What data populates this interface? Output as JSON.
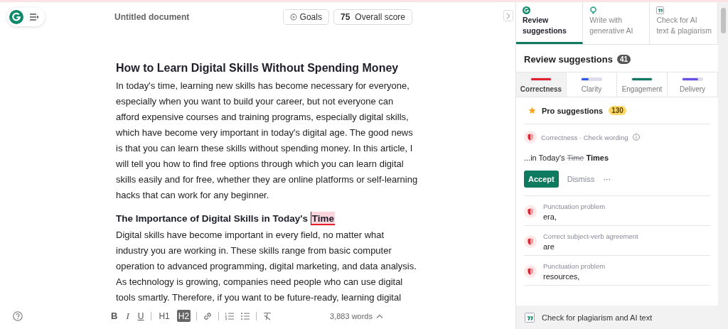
{
  "header": {
    "document_title": "Untitled document",
    "goals_label": "Goals",
    "score": "75",
    "score_label": "Overall score"
  },
  "document": {
    "title": "How to Learn Digital Skills Without Spending Money",
    "paragraph_1": "In today's time, learning new skills has become necessary for everyone, especially when you want to build your career, but not everyone can afford expensive courses and training programs, especially digital skills, which have become very important in today's digital age. The good news is that you can learn these skills without spending money. In this article, I will tell you how to find free options through which you can learn digital skills easily and for free, whether they are online platforms or self-learning hacks that can work for any beginner.",
    "heading_2": {
      "text": "The Importance of Digital Skills in Today's",
      "flagged_word": "Time"
    },
    "paragraph_2": "Digital skills have become important in every field, no matter what industry you are working in. These skills range from basic computer operation to advanced programming, digital marketing, and data analysis. As technology is growing, companies need people who can use digital tools smartly. Therefore, if you want to be future-ready, learning digital"
  },
  "toolbar": {
    "buttons": [
      {
        "kind": "bold",
        "label": "B",
        "selected": false
      },
      {
        "kind": "italic",
        "label": "I",
        "selected": false
      },
      {
        "kind": "underline",
        "label": "U",
        "selected": false
      },
      {
        "kind": "divider"
      },
      {
        "kind": "heading",
        "label": "H1",
        "selected": false
      },
      {
        "kind": "heading",
        "label": "H2",
        "selected": true
      },
      {
        "kind": "divider"
      },
      {
        "kind": "link"
      },
      {
        "kind": "divider"
      },
      {
        "kind": "ordered-list"
      },
      {
        "kind": "bullet-list"
      },
      {
        "kind": "divider"
      },
      {
        "kind": "clear-format"
      }
    ],
    "word_count": "3,883 words"
  },
  "panel": {
    "tabs": [
      {
        "kind": "review",
        "line_1": "Review",
        "line_2": "suggestions",
        "selected": true
      },
      {
        "kind": "write",
        "line_1": "Write with",
        "line_2": "generative AI",
        "selected": false
      },
      {
        "kind": "check",
        "line_1": "Check for AI",
        "line_2": "text & plagiarism",
        "selected": false
      }
    ],
    "heading": "Review suggestions",
    "count": "41",
    "categories": [
      {
        "label": "Correctness",
        "color": "#e5222c",
        "level": 1,
        "selected": true
      },
      {
        "label": "Clarity",
        "color": "#2d5be3",
        "level": 0.35,
        "selected": false
      },
      {
        "label": "Engagement",
        "color": "#0e7a5f",
        "level": 1,
        "selected": false
      },
      {
        "label": "Delivery",
        "color": "#6b4ee6",
        "level": 0.8,
        "selected": false
      }
    ],
    "pro": {
      "label": "Pro suggestions",
      "count": "130"
    },
    "active_card": {
      "category": "Correctness · Check wording",
      "context": "...in Today's",
      "removed": "Time",
      "replacement": "Times",
      "accept": "Accept",
      "dismiss": "Dismiss",
      "more": "···"
    },
    "items": [
      {
        "type": "Punctuation problem",
        "text": "era,"
      },
      {
        "type": "Correct subject-verb agreement",
        "text": "are"
      },
      {
        "type": "Punctuation problem",
        "text": "resources,"
      }
    ],
    "footer": "Check for plagiarism and AI text"
  }
}
